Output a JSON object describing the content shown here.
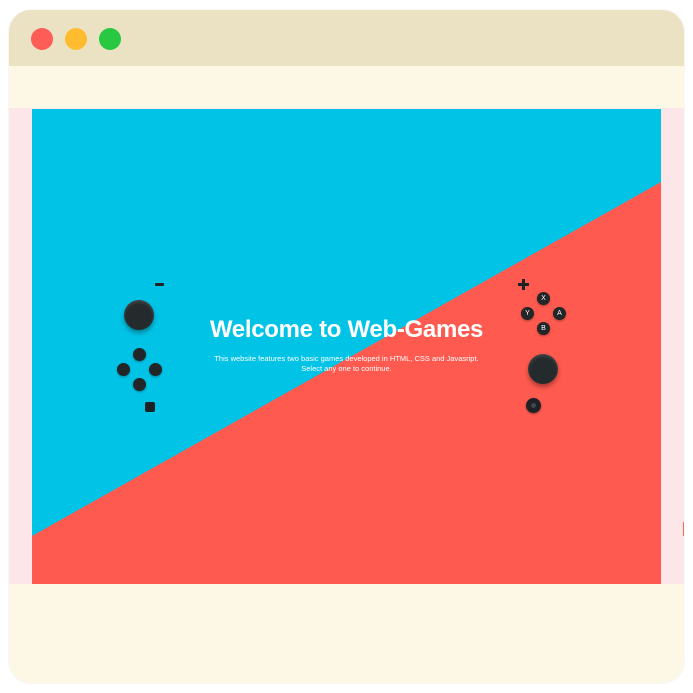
{
  "window": {
    "controls": [
      "close",
      "minimize",
      "maximize"
    ],
    "colors": {
      "close": "#fd5c57",
      "minimize": "#ffbc2e",
      "maximize": "#28c840"
    }
  },
  "hero": {
    "title": "Welcome to Web-Games",
    "subtitle_line1": "This website features two basic games developed in HTML, CSS and Javasript.",
    "subtitle_line2": "Select any one to continue.",
    "colors": {
      "left_panel": "#00c3e6",
      "right_panel": "#ff5a4f"
    }
  },
  "left_joycon": {
    "icons": [
      "minus-icon",
      "analog-stick",
      "dpad-up",
      "dpad-left",
      "dpad-right",
      "dpad-down",
      "capture-icon"
    ]
  },
  "right_joycon": {
    "buttons": {
      "x": "X",
      "y": "Y",
      "a": "A",
      "b": "B"
    },
    "icons": [
      "plus-icon",
      "analog-stick",
      "home-icon"
    ]
  }
}
